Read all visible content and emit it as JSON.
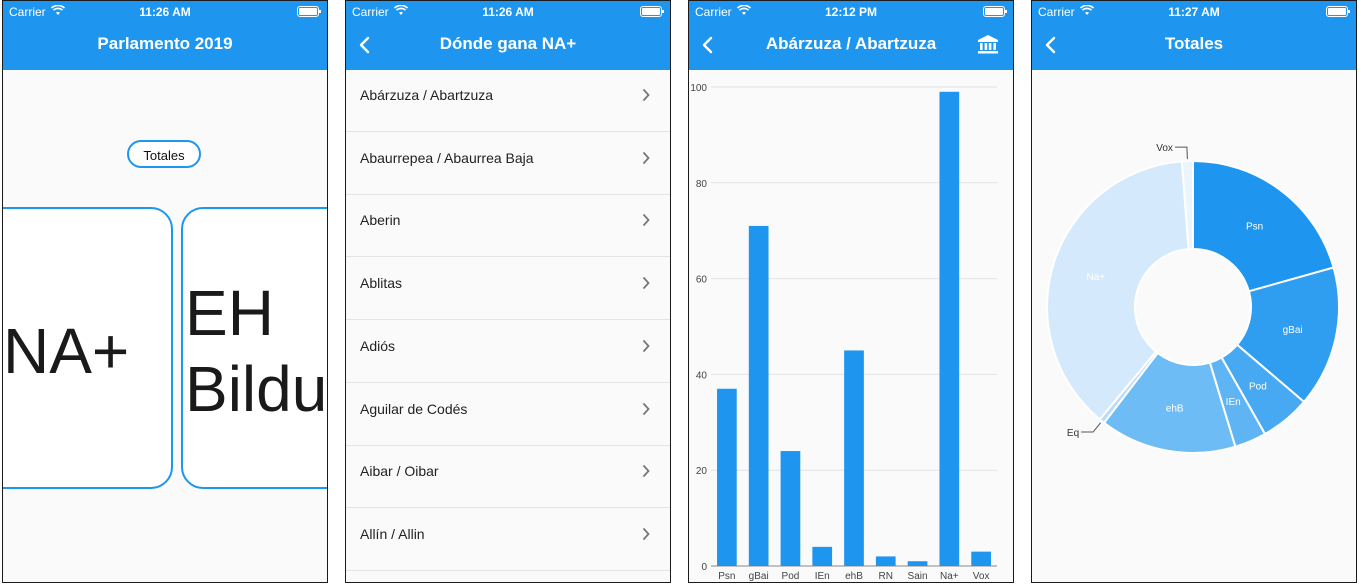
{
  "screens": [
    {
      "status": {
        "carrier": "Carrier",
        "time": "11:26 AM"
      },
      "title": "Parlamento 2019",
      "totales_button": "Totales",
      "cards": [
        "NA+",
        "EH",
        "Bildu"
      ]
    },
    {
      "status": {
        "carrier": "Carrier",
        "time": "11:26 AM"
      },
      "title": "Dónde gana NA+",
      "items": [
        "Abárzuza / Abartzuza",
        "Abaurrepea / Abaurrea Baja",
        "Aberin",
        "Ablitas",
        "Adiós",
        "Aguilar de Codés",
        "Aibar / Oibar",
        "Allín / Allin"
      ]
    },
    {
      "status": {
        "carrier": "Carrier",
        "time": "12:12 PM"
      },
      "title": "Abárzuza / Abartzuza"
    },
    {
      "status": {
        "carrier": "Carrier",
        "time": "11:27 AM"
      },
      "title": "Totales"
    }
  ],
  "colors": {
    "accent": "#1e96ef",
    "bar": "#1e96ef"
  },
  "chart_data": [
    {
      "type": "bar",
      "categories": [
        "Psn",
        "gBai",
        "Pod",
        "IEn",
        "ehB",
        "RN",
        "Sain",
        "Na+",
        "Vox"
      ],
      "values": [
        37,
        71,
        24,
        4,
        45,
        2,
        1,
        99,
        3
      ],
      "ylim": [
        0,
        100
      ],
      "yticks": [
        0,
        20,
        40,
        60,
        80,
        100
      ],
      "grid": true
    },
    {
      "type": "pie",
      "labels": [
        "Psn",
        "gBai",
        "Pod",
        "IEn",
        "ehB",
        "Eq",
        "Na+",
        "Vox"
      ],
      "values": [
        20.5,
        15.5,
        5.5,
        3.5,
        15.0,
        0.6,
        37.5,
        1.2
      ],
      "colors": [
        "#1e96ef",
        "#2f9df0",
        "#46a9f2",
        "#5fb4f4",
        "#6ebcf5",
        "#b9dcfa",
        "#d4e9fc",
        "#eaf5fe"
      ],
      "donut": true
    }
  ]
}
